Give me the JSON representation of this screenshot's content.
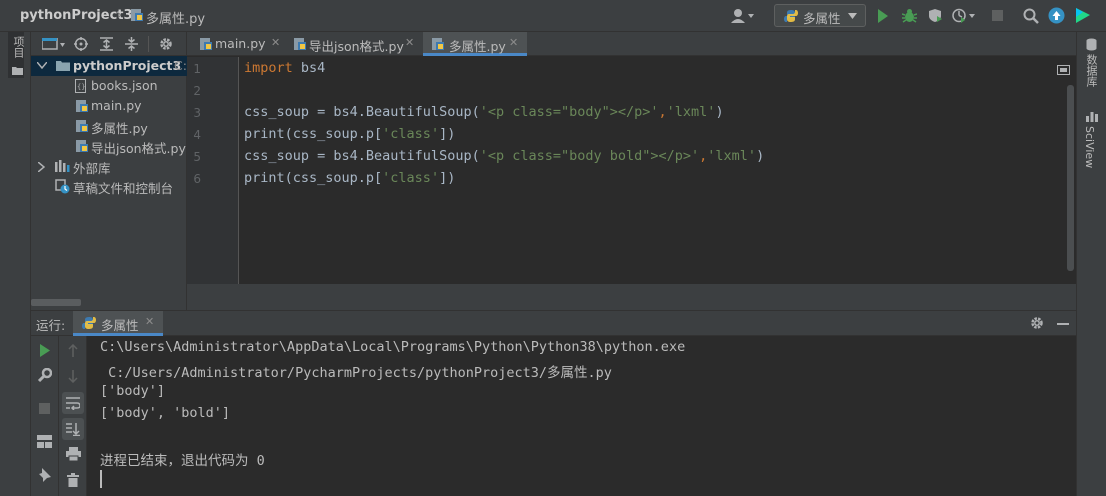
{
  "breadcrumb": {
    "project": "pythonProject3",
    "file": "多属性.py"
  },
  "toolbar": {
    "run_config": "多属性"
  },
  "left_strip": {
    "project_label": "项目"
  },
  "right_strip": {
    "database_label": "数据库",
    "sciview_label": "SciView"
  },
  "project_tree": {
    "root": "pythonProject3",
    "root_path_hint": "C:\\",
    "files": [
      "books.json",
      "main.py",
      "多属性.py",
      "导出json格式.py"
    ],
    "external": "外部库",
    "scratches": "草稿文件和控制台"
  },
  "tabs": [
    {
      "label": "main.py",
      "active": false
    },
    {
      "label": "导出json格式.py",
      "active": false
    },
    {
      "label": "多属性.py",
      "active": true
    }
  ],
  "editor": {
    "line_numbers": [
      "1",
      "2",
      "3",
      "4",
      "5",
      "6"
    ],
    "lines": [
      {
        "kw": "import",
        "rest": " bs4"
      },
      {
        "text": ""
      },
      {
        "a": "css_soup = bs4.BeautifulSoup(",
        "s1": "'<p class=\"body\"></p>'",
        "b": ",",
        "s2": "'lxml'",
        "c": ")"
      },
      {
        "a": "print(css_soup.p[",
        "s1": "'class'",
        "c": "])"
      },
      {
        "a": "css_soup = bs4.BeautifulSoup(",
        "s1": "'<p class=\"body bold\"></p>'",
        "b": ",",
        "s2": "'lxml'",
        "c": ")"
      },
      {
        "a": "print(css_soup.p[",
        "s1": "'class'",
        "c": "])"
      }
    ]
  },
  "run_panel": {
    "label": "运行:",
    "tab": "多属性",
    "output": [
      "C:\\Users\\Administrator\\AppData\\Local\\Programs\\Python\\Python38\\python.exe",
      " C:/Users/Administrator/PycharmProjects/pythonProject3/多属性.py",
      "['body']",
      "['body', 'bold']",
      "",
      "进程已结束，退出代码为 0"
    ]
  },
  "colors": {
    "accent": "#4a88c7",
    "run_green": "#499c54",
    "keyword": "#cc7832",
    "string": "#6a8759"
  }
}
